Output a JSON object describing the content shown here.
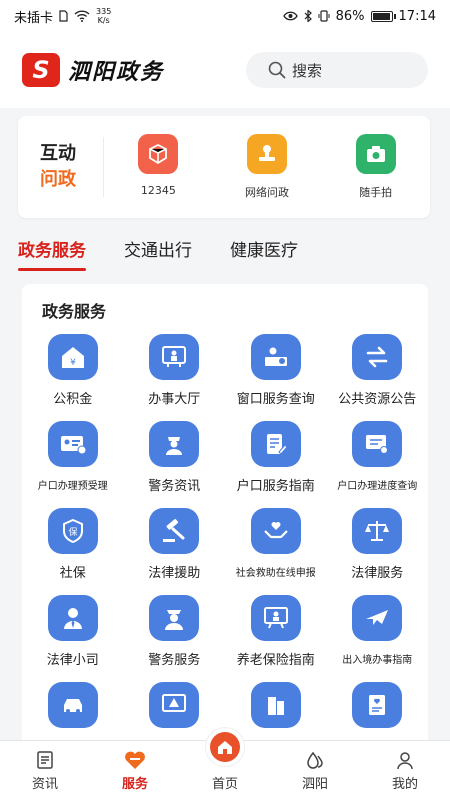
{
  "status_bar": {
    "carrier": "未插卡",
    "speed_value": "335",
    "speed_unit": "K/s",
    "battery": "86%",
    "battery_level": 0.86,
    "time": "17:14"
  },
  "header": {
    "logo_mark": "S",
    "app_name": "泗阳政务",
    "search_placeholder": "搜索"
  },
  "interact": {
    "title_line1": "互动",
    "title_line2": "问政",
    "items": [
      {
        "label": "12345",
        "color": "#f2624a"
      },
      {
        "label": "网络问政",
        "color": "#f5a623"
      },
      {
        "label": "随手拍",
        "color": "#2fb36b"
      }
    ]
  },
  "tabs": [
    "政务服务",
    "交通出行",
    "健康医疗"
  ],
  "panel": {
    "title": "政务服务",
    "services": [
      {
        "label": "公积金"
      },
      {
        "label": "办事大厅"
      },
      {
        "label": "窗口服务查询"
      },
      {
        "label": "公共资源公告"
      },
      {
        "label": "户口办理预受理"
      },
      {
        "label": "警务资讯"
      },
      {
        "label": "户口服务指南"
      },
      {
        "label": "户口办理进度查询"
      },
      {
        "label": "社保"
      },
      {
        "label": "法律援助"
      },
      {
        "label": "社会救助在线申报"
      },
      {
        "label": "法律服务"
      },
      {
        "label": "法律小司"
      },
      {
        "label": "警务服务"
      },
      {
        "label": "养老保险指南"
      },
      {
        "label": "出入境办事指南"
      }
    ]
  },
  "bottom_nav": [
    "资讯",
    "服务",
    "首页",
    "泗阳",
    "我的"
  ],
  "colors": {
    "accent": "#d8231d",
    "service_icon": "#4a7fe0",
    "interact_orange": "#f06a1e"
  }
}
